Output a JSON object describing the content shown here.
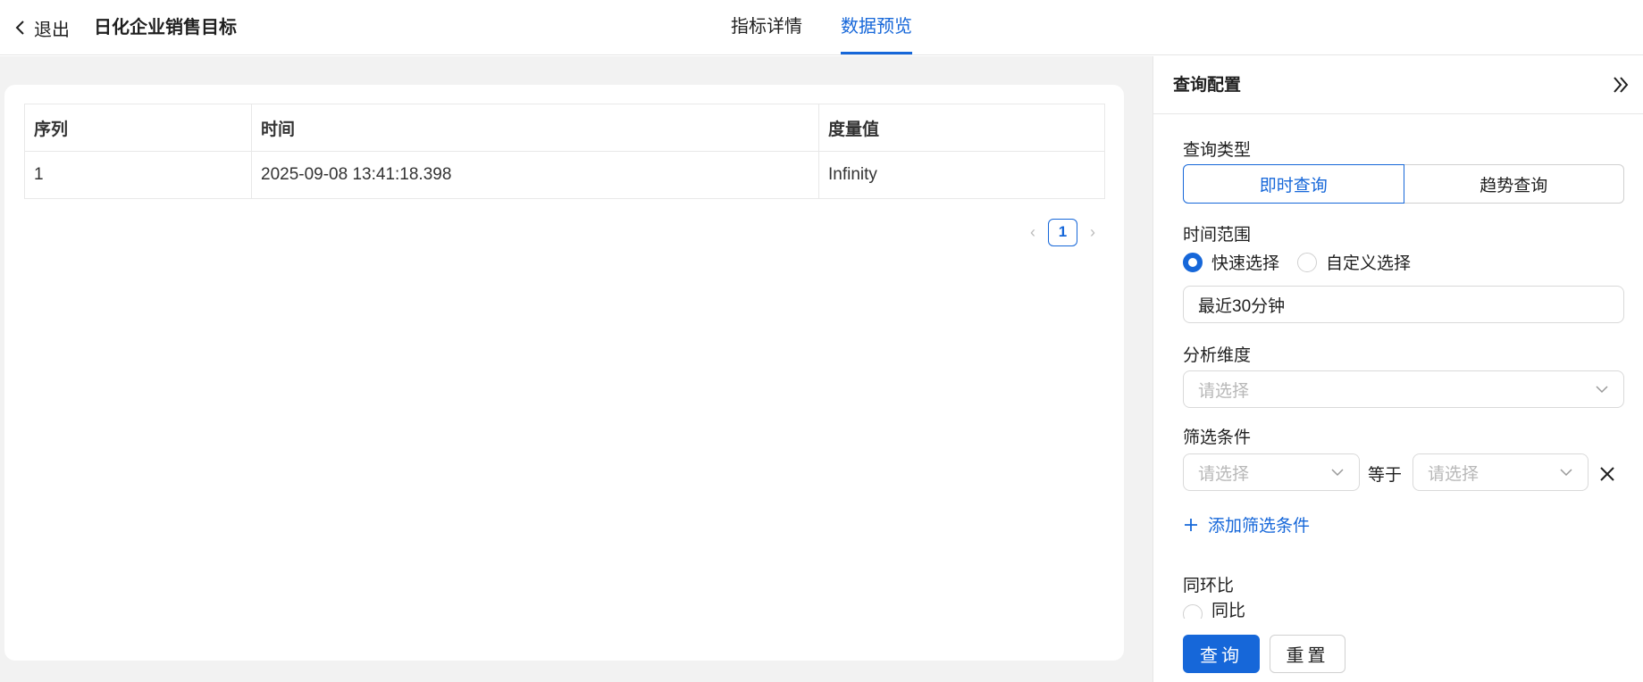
{
  "header": {
    "back_label": "退出",
    "title": "日化企业销售目标",
    "tabs": [
      {
        "label": "指标详情",
        "active": false
      },
      {
        "label": "数据预览",
        "active": true
      }
    ]
  },
  "table": {
    "columns": [
      "序列",
      "时间",
      "度量值"
    ],
    "rows": [
      [
        "1",
        "2025-09-08 13:41:18.398",
        "Infinity"
      ]
    ]
  },
  "pagination": {
    "current_page": "1"
  },
  "panel": {
    "title": "查询配置",
    "query_type": {
      "label": "查询类型",
      "options": [
        "即时查询",
        "趋势查询"
      ],
      "selected": "即时查询"
    },
    "time_range": {
      "label": "时间范围",
      "radio_options": [
        "快速选择",
        "自定义选择"
      ],
      "selected": "快速选择",
      "value": "最近30分钟"
    },
    "dimension": {
      "label": "分析维度",
      "placeholder": "请选择"
    },
    "filter": {
      "label": "筛选条件",
      "field_placeholder": "请选择",
      "operator": "等于",
      "value_placeholder": "请选择",
      "add_label": "添加筛选条件"
    },
    "comparison": {
      "label": "同环比",
      "option_partial": "同比"
    },
    "buttons": {
      "query": "查询",
      "reset": "重置"
    }
  },
  "colors": {
    "accent": "#1667d9",
    "border": "#d9d9d9",
    "page_bg": "#f2f2f2"
  }
}
